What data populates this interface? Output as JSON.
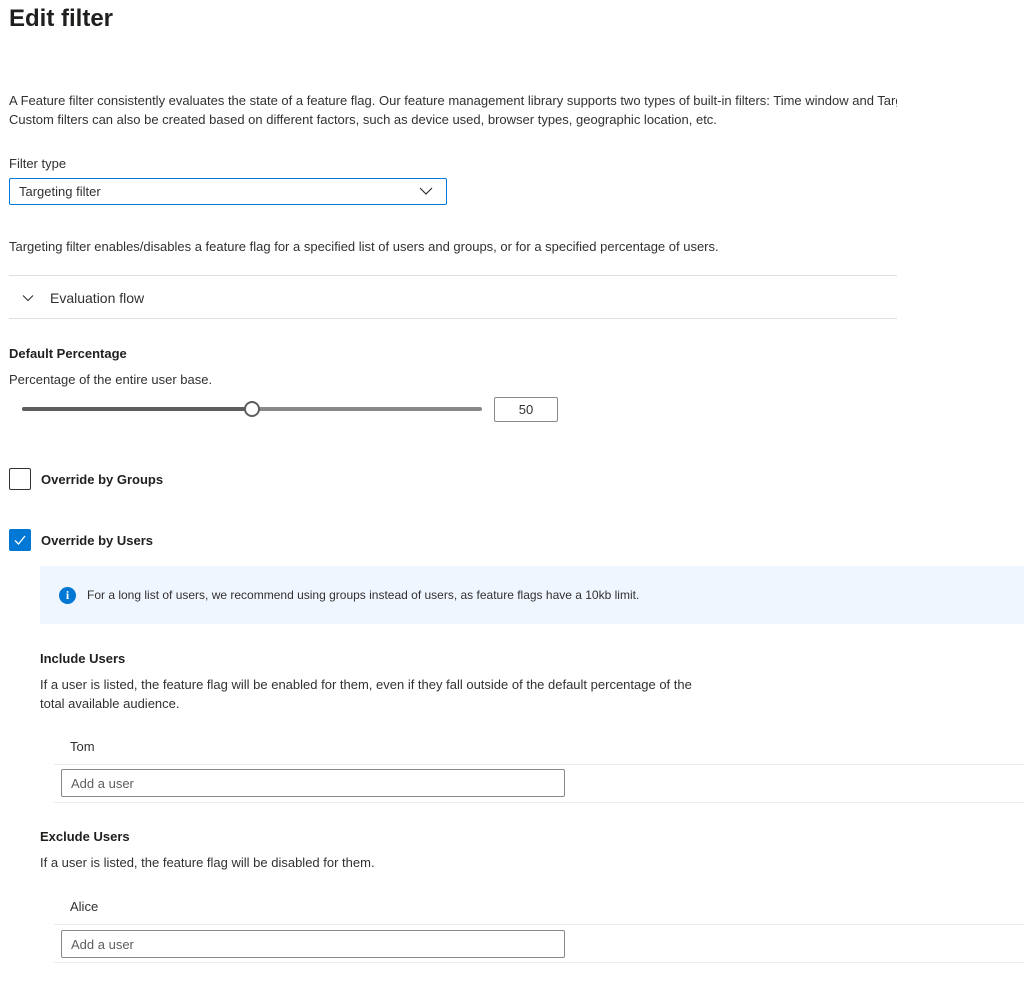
{
  "page": {
    "title": "Edit filter",
    "description_line1": "A Feature filter consistently evaluates the state of a feature flag. Our feature management library supports two types of built-in filters: Time window and Targeting.",
    "description_line2": "Custom filters can also be created based on different factors, such as device used, browser types, geographic location, etc."
  },
  "filter_type": {
    "label": "Filter type",
    "selected": "Targeting filter",
    "icon": "chevron-down-icon",
    "help_text": "Targeting filter enables/disables a feature flag for a specified list of users and groups, or for a specified percentage of users."
  },
  "evaluation_flow": {
    "label": "Evaluation flow",
    "icon": "chevron-down-icon"
  },
  "default_percentage": {
    "heading": "Default Percentage",
    "description": "Percentage of the entire user base.",
    "value": "50",
    "slider_fraction": 0.5
  },
  "override_groups": {
    "label": "Override by Groups",
    "checked": false
  },
  "override_users": {
    "label": "Override by Users",
    "checked": true,
    "info_text": "For a long list of users, we recommend using groups instead of users, as feature flags have a 10kb limit.",
    "info_icon": "info-icon"
  },
  "include_users": {
    "heading": "Include Users",
    "description": "If a user is listed, the feature flag will be enabled for them, even if they fall outside of the default percentage of the total available audience.",
    "users": [
      "Tom"
    ],
    "input_placeholder": "Add a user"
  },
  "exclude_users": {
    "heading": "Exclude Users",
    "description": "If a user is listed, the feature flag will be disabled for them.",
    "users": [
      "Alice"
    ],
    "input_placeholder": "Add a user"
  },
  "colors": {
    "accent": "#0078d4",
    "info_background": "#f0f6ff"
  }
}
